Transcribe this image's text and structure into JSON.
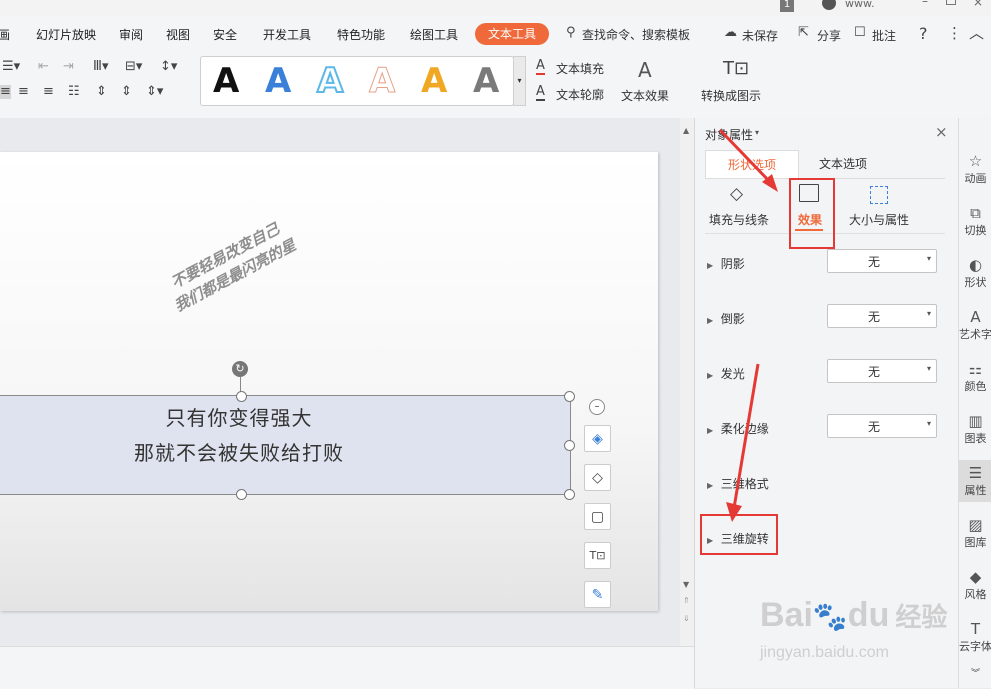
{
  "menubar": {
    "items": [
      "画",
      "幻灯片放映",
      "审阅",
      "视图",
      "安全",
      "开发工具",
      "特色功能",
      "绘图工具"
    ],
    "active_tab": "文本工具",
    "search": "查找命令、搜索模板",
    "unsaved": "未保存",
    "share": "分享",
    "annotate": "批注",
    "help": "?",
    "more": "⋮"
  },
  "topbar": {
    "page_badge": "1",
    "user": "www."
  },
  "ribbon": {
    "text_fill": "文本填充",
    "text_outline": "文本轮廓",
    "text_effect": "文本效果",
    "convert": "转换成图示",
    "gallery_colors": [
      "#111111",
      "#3a7fd8",
      "#5bb8e8",
      "#e9a08a",
      "#f0a824",
      "#7a7a7a"
    ]
  },
  "slide": {
    "rotated_line1": "不要轻易改变自己",
    "rotated_line2": "我们都是最闪亮的星",
    "box_line1": "只有你变得强大",
    "box_line2": "那就不会被失败给打败"
  },
  "panel": {
    "title": "对象属性",
    "tabs": [
      "形状选项",
      "文本选项"
    ],
    "subtabs": [
      "填充与线条",
      "效果",
      "大小与属性"
    ],
    "rows": [
      {
        "label": "阴影",
        "value": "无"
      },
      {
        "label": "倒影",
        "value": "无"
      },
      {
        "label": "发光",
        "value": "无"
      },
      {
        "label": "柔化边缘",
        "value": "无"
      },
      {
        "label": "三维格式"
      },
      {
        "label": "三维旋转"
      }
    ]
  },
  "rightbar": [
    "动画",
    "切换",
    "形状",
    "艺术字",
    "颜色",
    "图表",
    "属性",
    "图库",
    "风格",
    "云字体"
  ],
  "watermark": {
    "logo": "Bai",
    "logo2": "du",
    "name": "经验",
    "url": "jingyan.baidu.com"
  },
  "accent": "#f0693a",
  "highlight": "#e53935"
}
